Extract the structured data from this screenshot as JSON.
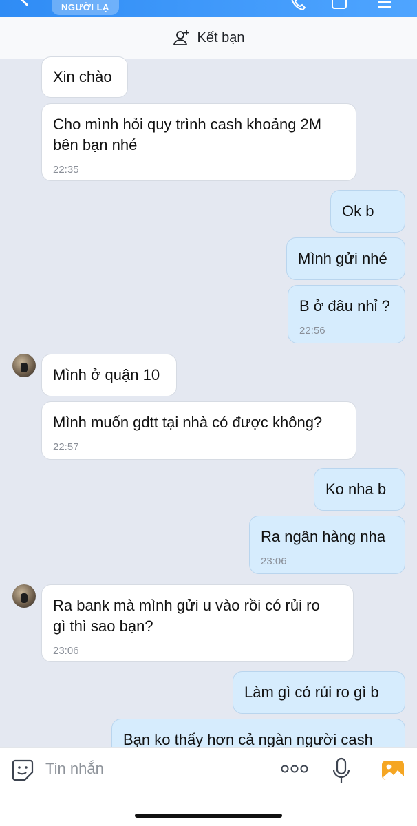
{
  "header": {
    "stranger_badge": "NGƯỜI LẠ",
    "add_friend_label": "Kết bạn"
  },
  "messages": [
    {
      "dir": "in",
      "text": "Xin chào",
      "time": ""
    },
    {
      "dir": "in",
      "text": "Cho mình hỏi quy trình cash khoảng 2M\nbên bạn nhé",
      "time": "22:35"
    },
    {
      "dir": "out",
      "text": "Ok b",
      "time": ""
    },
    {
      "dir": "out",
      "text": "Mình gửi nhé",
      "time": ""
    },
    {
      "dir": "out",
      "text": "B ở đâu nhỉ ?",
      "time": "22:56"
    },
    {
      "dir": "in",
      "text": "Mình ở quận 10",
      "time": ""
    },
    {
      "dir": "in",
      "text": "Mình muốn gdtt tại nhà có được không?",
      "time": "22:57"
    },
    {
      "dir": "out",
      "text": "Ko nha b",
      "time": ""
    },
    {
      "dir": "out",
      "text": "Ra ngân hàng nha",
      "time": "23:06"
    },
    {
      "dir": "in",
      "text": "Ra bank mà mình gửi u vào rồi có rủi ro\ngì thì sao bạn?",
      "time": "23:06"
    },
    {
      "dir": "out",
      "text": "Làm gì có rủi ro gì b",
      "time": ""
    },
    {
      "dir": "out",
      "text": "Bạn ko thấy hơn cả ngàn người cash",
      "time": ""
    }
  ],
  "input": {
    "placeholder": "Tin nhắn"
  },
  "icons": {
    "back": "chevron-left-icon",
    "add_friend": "add-user-icon",
    "emoji": "sticker-icon",
    "more": "more-dots-icon",
    "mic": "microphone-icon",
    "image": "image-icon"
  },
  "colors": {
    "header_blue": "#2f8cf5",
    "outgoing_bubble": "#d6ecfd",
    "incoming_bubble": "#ffffff",
    "chat_background": "#e4e8f1",
    "image_icon": "#f5a623"
  }
}
